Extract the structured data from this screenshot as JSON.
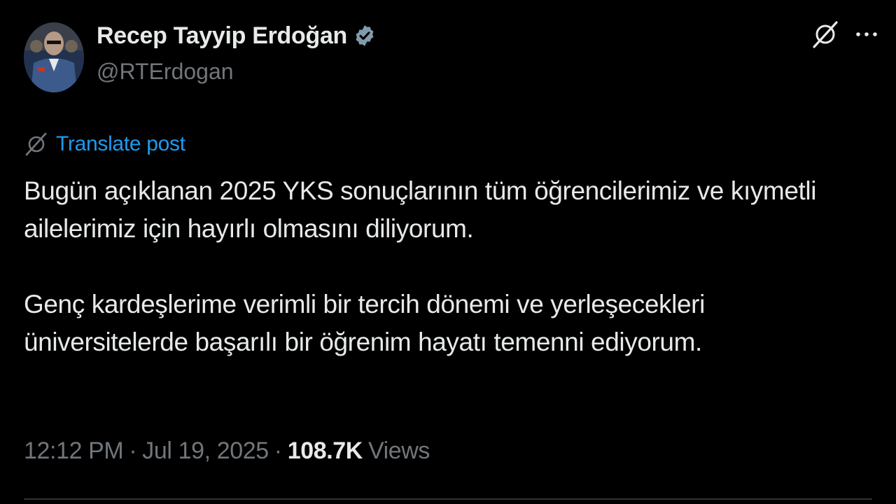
{
  "author": {
    "display_name": "Recep Tayyip Erdoğan",
    "handle": "@RTErdogan",
    "verified": true,
    "verified_badge_color": "#829aab"
  },
  "header": {
    "grok_icon": "grok-icon",
    "more_icon": "more-horizontal-icon"
  },
  "translate": {
    "label": "Translate post",
    "icon": "grok-icon",
    "color": "#1d9bf0"
  },
  "post": {
    "paragraphs": [
      "Bugün açıklanan 2025 YKS sonuçlarının tüm öğrencilerimiz ve kıymetli ailelerimiz için hayırlı olmasını diliyorum.",
      "Genç kardeşlerime verimli bir tercih dönemi ve yerleşecekleri üniversitelerde başarılı bir öğrenim hayatı temenni ediyorum."
    ]
  },
  "meta": {
    "time": "12:12 PM",
    "separator": "·",
    "date": "Jul 19, 2025",
    "views_count": "108.7K",
    "views_label": "Views"
  },
  "colors": {
    "background": "#000000",
    "text": "#e7e9ea",
    "secondary_text": "#71767b",
    "link": "#1d9bf0"
  }
}
